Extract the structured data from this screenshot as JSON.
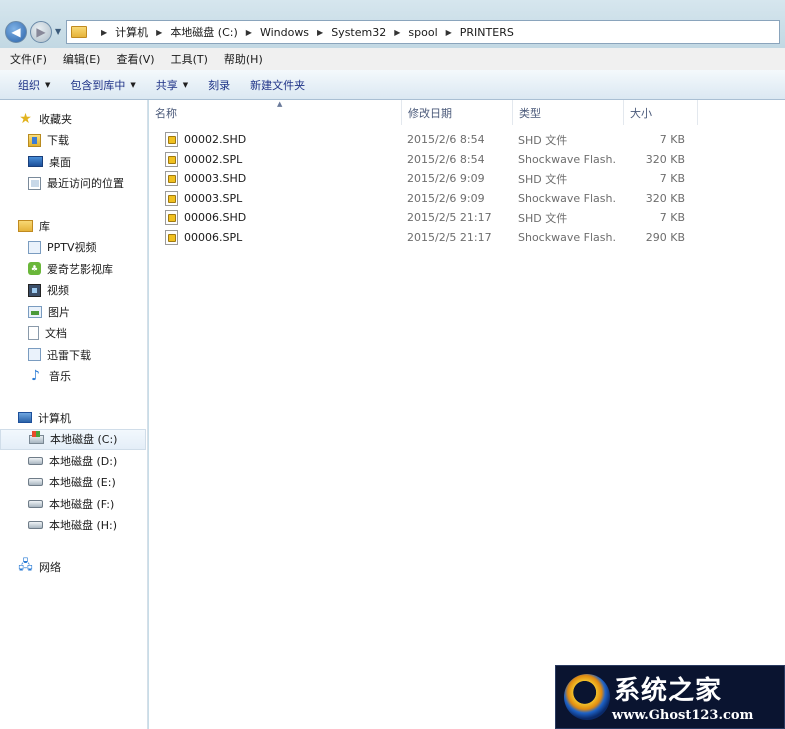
{
  "address": {
    "crumbs": [
      "计算机",
      "本地磁盘 (C:)",
      "Windows",
      "System32",
      "spool",
      "PRINTERS"
    ]
  },
  "menu": [
    "文件(F)",
    "编辑(E)",
    "查看(V)",
    "工具(T)",
    "帮助(H)"
  ],
  "toolbar": {
    "organize": "组织",
    "include_library": "包含到库中",
    "share": "共享",
    "burn": "刻录",
    "new_folder": "新建文件夹"
  },
  "sidebar": {
    "favorites": {
      "label": "收藏夹",
      "items": [
        "下载",
        "桌面",
        "最近访问的位置"
      ]
    },
    "libraries": {
      "label": "库",
      "items": [
        "PPTV视频",
        "爱奇艺影视库",
        "视频",
        "图片",
        "文档",
        "迅雷下载",
        "音乐"
      ]
    },
    "computer": {
      "label": "计算机",
      "items": [
        "本地磁盘 (C:)",
        "本地磁盘 (D:)",
        "本地磁盘 (E:)",
        "本地磁盘 (F:)",
        "本地磁盘 (H:)"
      ],
      "selected": "本地磁盘 (C:)"
    },
    "network": {
      "label": "网络"
    }
  },
  "columns": {
    "name": "名称",
    "date": "修改日期",
    "type": "类型",
    "size": "大小"
  },
  "files": [
    {
      "name": "00002.SHD",
      "date": "2015/2/6 8:54",
      "type": "SHD 文件",
      "size": "7 KB"
    },
    {
      "name": "00002.SPL",
      "date": "2015/2/6 8:54",
      "type": "Shockwave Flash...",
      "size": "320 KB"
    },
    {
      "name": "00003.SHD",
      "date": "2015/2/6 9:09",
      "type": "SHD 文件",
      "size": "7 KB"
    },
    {
      "name": "00003.SPL",
      "date": "2015/2/6 9:09",
      "type": "Shockwave Flash...",
      "size": "320 KB"
    },
    {
      "name": "00006.SHD",
      "date": "2015/2/5 21:17",
      "type": "SHD 文件",
      "size": "7 KB"
    },
    {
      "name": "00006.SPL",
      "date": "2015/2/5 21:17",
      "type": "Shockwave Flash...",
      "size": "290 KB"
    }
  ],
  "watermark": {
    "title": "系统之家",
    "url": "www.Ghost123.com"
  }
}
